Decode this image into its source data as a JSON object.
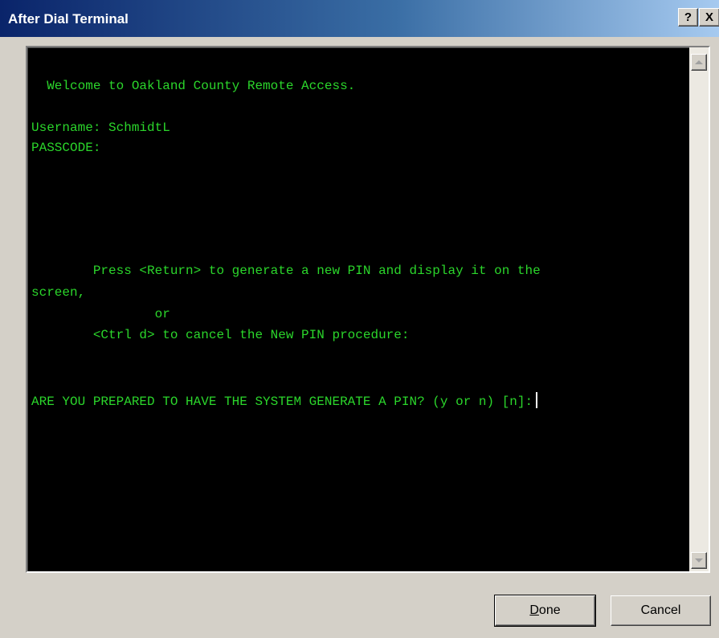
{
  "window": {
    "title": "After Dial Terminal",
    "help_label": "?",
    "close_label": "X"
  },
  "terminal": {
    "lines": [
      "  Welcome to Oakland County Remote Access.",
      "",
      "Username: SchmidtL",
      "PASSCODE:",
      "",
      "",
      "",
      "",
      "",
      "",
      "        Press <Return> to generate a new PIN and display it on the",
      "screen,",
      "                or",
      "        <Ctrl d> to cancel the New PIN procedure:",
      "",
      "",
      "ARE YOU PREPARED TO HAVE THE SYSTEM GENERATE A PIN? (y or n) [n]:"
    ],
    "text_color": "#2bd62b",
    "background": "#000000"
  },
  "buttons": {
    "done_label": "Done",
    "cancel_label": "Cancel"
  }
}
